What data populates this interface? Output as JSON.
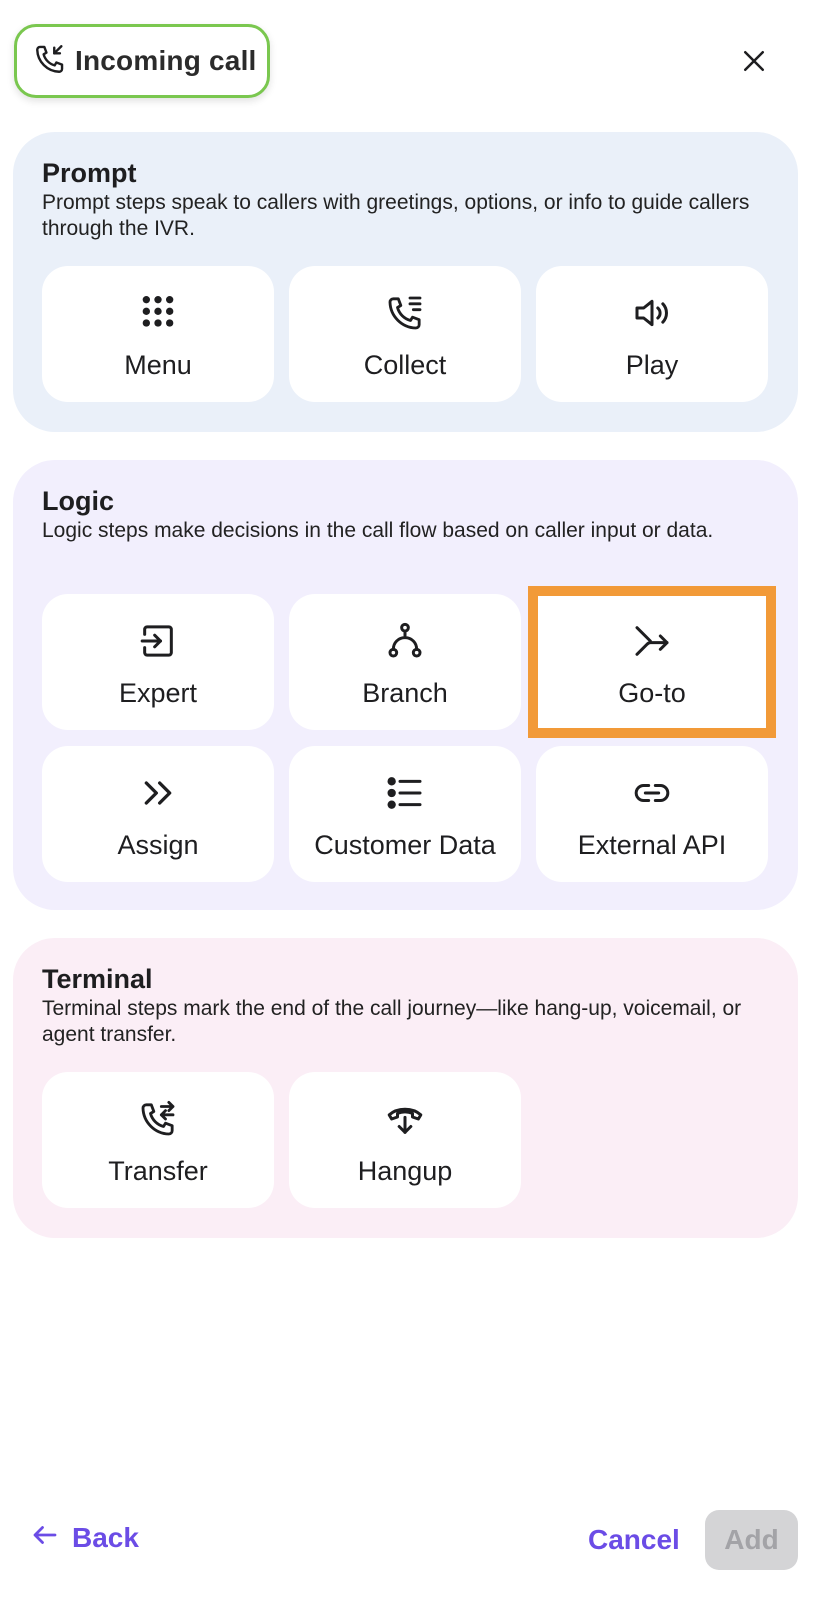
{
  "header": {
    "title": "Incoming call",
    "title_icon": "incoming-call-icon",
    "close_icon": "close-icon"
  },
  "sections": [
    {
      "title": "Prompt",
      "description": "Prompt steps speak to callers with greetings, options, or info to guide callers through the IVR.",
      "items": [
        {
          "label": "Menu",
          "icon": "keypad-icon"
        },
        {
          "label": "Collect",
          "icon": "phone-list-icon"
        },
        {
          "label": "Play",
          "icon": "speaker-icon"
        }
      ]
    },
    {
      "title": "Logic",
      "description": "Logic steps make decisions in the call flow based on caller input or data.",
      "items": [
        {
          "label": "Expert",
          "icon": "expert-enter-icon"
        },
        {
          "label": "Branch",
          "icon": "branch-icon"
        },
        {
          "label": "Go-to",
          "icon": "goto-arrow-icon",
          "selected": true
        },
        {
          "label": "Assign",
          "icon": "double-chevron-icon"
        },
        {
          "label": "Customer Data",
          "icon": "list-icon"
        },
        {
          "label": "External API",
          "icon": "link-icon"
        }
      ]
    },
    {
      "title": "Terminal",
      "description": "Terminal steps mark the end of the call journey—like hang-up, voicemail, or agent transfer.",
      "items": [
        {
          "label": "Transfer",
          "icon": "phone-transfer-icon"
        },
        {
          "label": "Hangup",
          "icon": "hangup-icon"
        }
      ]
    }
  ],
  "footer": {
    "back_label": "Back",
    "cancel_label": "Cancel",
    "add_label": "Add"
  },
  "colors": {
    "accent": "#6b4ce6",
    "chip_border": "#7ac74f",
    "selected_outline": "#f29a38",
    "prompt_bg": "#eaf0f9",
    "logic_bg": "#f2effd",
    "terminal_bg": "#fbeef6"
  }
}
